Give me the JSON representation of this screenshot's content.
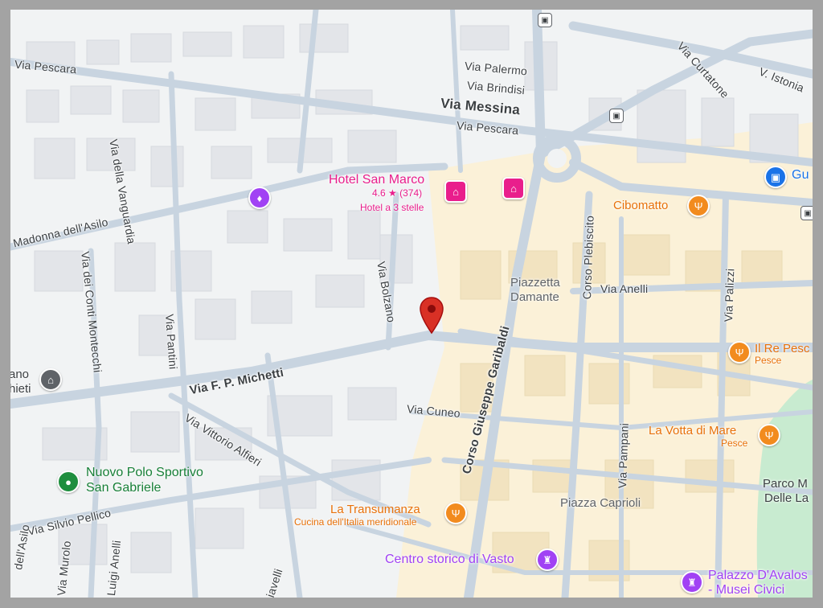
{
  "colors": {
    "frame": "#a3a3a3",
    "background": "#f1f3f4",
    "road": "#c7d3df",
    "main_road": "#b9c6d4",
    "building": "#e4e6ea",
    "historic_block": "#fbf1d8",
    "park": "#c8ebd0",
    "food": "#f28b1e",
    "hotel": "#e91e8c",
    "attraction": "#a142f4",
    "pin": "#d93025"
  },
  "streets": {
    "via_pescara_top": "Via Pescara",
    "via_palermo": "Via Palermo",
    "via_brindisi": "Via Brindisi",
    "via_messina": "Via Messina",
    "via_pescara_mid": "Via Pescara",
    "via_curtatone": "Via Curtatone",
    "v_istonia": "V. Istonia",
    "via_della_vanguardia": "Via della Vanguardia",
    "madonna_asilo": "Madonna dell'Asilo",
    "via_conti_montecchi": "Via dei Conti Montecchi",
    "via_pantini": "Via Pantini",
    "via_bolzano": "Via Bolzano",
    "via_michetti": "Via F. P. Michetti",
    "via_vittorio_alfieri": "Via Vittorio Alfieri",
    "via_cuneo": "Via Cuneo",
    "corso_garibaldi": "Corso Giuseppe Garibaldi",
    "corso_plebiscito": "Corso Plebiscito",
    "via_anelli": "Via Anelli",
    "via_palizzi": "Via Palizzi",
    "via_pampani": "Via Pampani",
    "via_silvio_pellico": "Via Silvio Pellico",
    "dell_asilo": "dell'Asilo",
    "via_murolo": "Via Murolo",
    "luigi_anelli": "Luigi Anelli",
    "viavelli": "iavelli"
  },
  "places": {
    "piazzetta_damante_l1": "Piazzetta",
    "piazzetta_damante_l2": "Damante",
    "piazza_caprioli": "Piazza Caprioli",
    "museum_partial_l1": "ano",
    "museum_partial_l2": "hieti"
  },
  "pois": {
    "hotel_san_marco": {
      "name": "Hotel San Marco",
      "rating": "4.6",
      "star": "★",
      "reviews": "(374)",
      "category": "Hotel a 3 stelle"
    },
    "cibomatto": {
      "name": "Cibomatto"
    },
    "il_re_pesce": {
      "name": "Il Re Pesc",
      "category": "Pesce"
    },
    "la_votta_di_mare": {
      "name": "La Votta di Mare",
      "category": "Pesce"
    },
    "la_transumanza": {
      "name": "La Transumanza",
      "category": "Cucina dell'Italia meridionale"
    },
    "centro_storico": {
      "name": "Centro storico di Vasto"
    },
    "palazzo_davalos": {
      "name_l1": "Palazzo D'Avalos",
      "name_l2": "- Musei Civici"
    },
    "nuovo_polo_sportivo": {
      "name_l1": "Nuovo Polo Sportivo",
      "name_l2": "San Gabriele"
    },
    "parco": {
      "name_l1": "Parco M",
      "name_l2": "Delle La"
    },
    "shop_partial": {
      "name": "Gu"
    }
  },
  "icons": {
    "restaurant": "fork-knife-icon",
    "hotel": "bed-icon",
    "attraction": "castle-icon",
    "museum": "museum-icon",
    "shop": "shopping-bag-icon",
    "park": "park-icon",
    "transit": "bus-stop-icon",
    "pin": "map-pin-icon"
  }
}
